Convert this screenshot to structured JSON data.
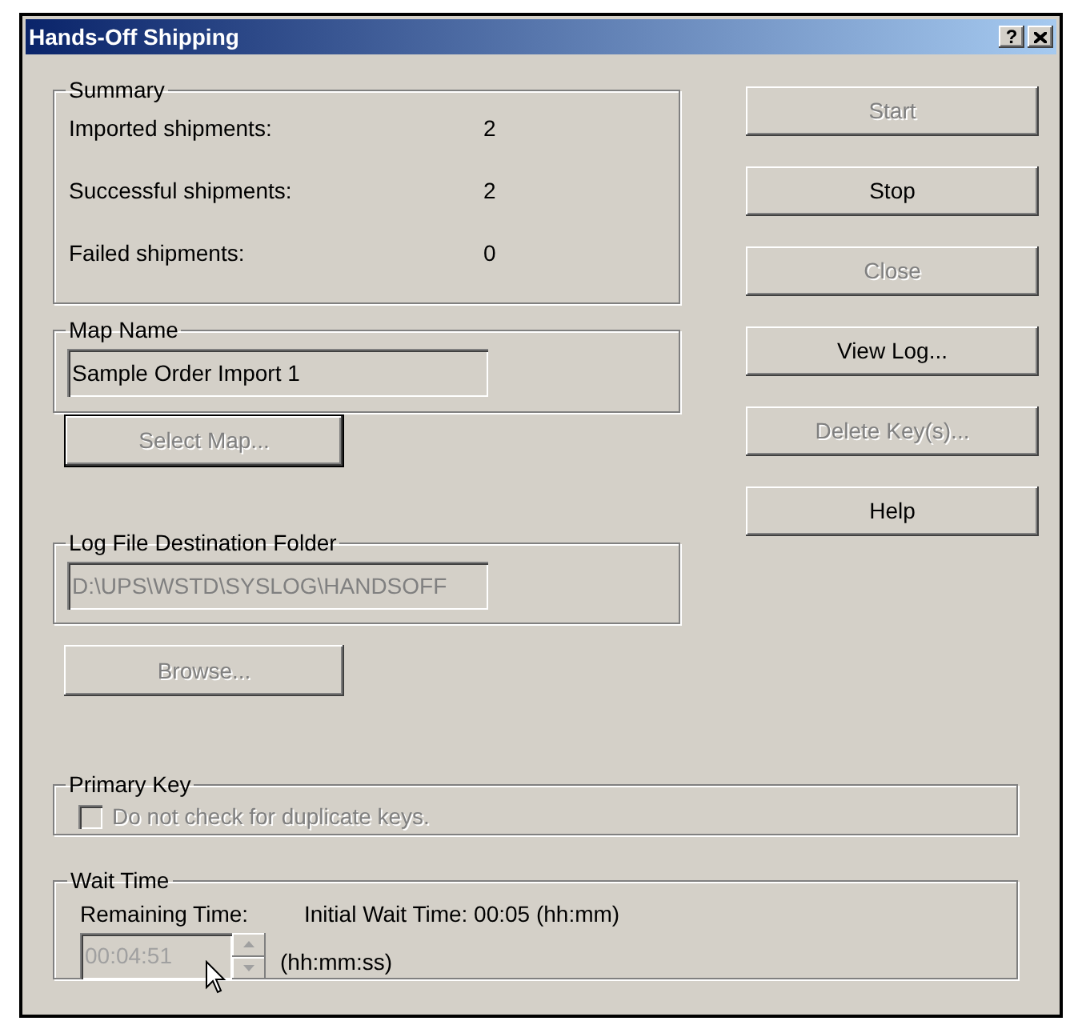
{
  "window": {
    "title": "Hands-Off Shipping"
  },
  "title_buttons": [
    {
      "kind": "help",
      "label": "?"
    },
    {
      "kind": "close"
    }
  ],
  "summary": {
    "label": "Summary",
    "rows": [
      {
        "label": "Imported shipments:",
        "value": "2"
      },
      {
        "label": "Successful shipments:",
        "value": "2"
      },
      {
        "label": "Failed shipments:",
        "value": "0"
      }
    ]
  },
  "map_name": {
    "label": "Map Name",
    "value": "Sample Order Import 1"
  },
  "select_map_button": {
    "label": "Select Map...",
    "disabled": true
  },
  "log_folder": {
    "label": "Log File Destination Folder",
    "value": "D:\\UPS\\WSTD\\SYSLOG\\HANDSOFF",
    "disabled": true
  },
  "browse_button": {
    "label": "Browse...",
    "disabled": true
  },
  "actions": [
    {
      "label": "Start",
      "disabled": true
    },
    {
      "label": "Stop",
      "disabled": false
    },
    {
      "label": "Close",
      "disabled": true
    },
    {
      "label": "View Log...",
      "disabled": false
    },
    {
      "label": "Delete Key(s)...",
      "disabled": true
    },
    {
      "label": "Help",
      "disabled": false
    }
  ],
  "primary_key": {
    "label": "Primary Key",
    "checkbox": {
      "label": "Do not check for duplicate keys.",
      "checked": false,
      "disabled": true
    }
  },
  "wait_time": {
    "label": "Wait Time",
    "remaining_label": "Remaining Time:",
    "initial": "Initial Wait Time: 00:05 (hh:mm)",
    "remaining_value": "00:04:51",
    "disabled": true,
    "unit": "(hh:mm:ss)"
  }
}
